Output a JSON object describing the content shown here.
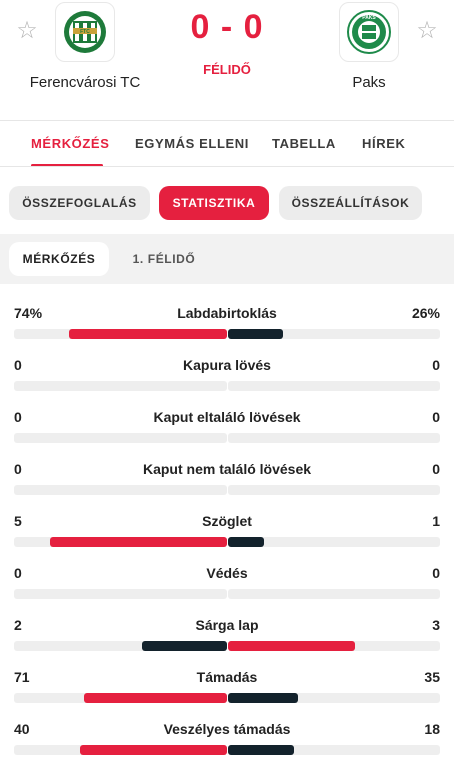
{
  "header": {
    "home_team": "Ferencvárosi TC",
    "away_team": "Paks",
    "score": "0 - 0",
    "status": "FÉLIDŐ",
    "home_logo_text": "FTC",
    "away_logo_text": "PAKS"
  },
  "main_tabs": [
    "MÉRKŐZÉS",
    "EGYMÁS ELLENI",
    "TABELLA",
    "HÍREK"
  ],
  "sub_tabs": [
    "ÖSSZEFOGLALÁS",
    "STATISZTIKA",
    "ÖSSZEÁLLÍTÁSOK"
  ],
  "periods": [
    "MÉRKŐZÉS",
    "1. FÉLIDŐ"
  ],
  "colors": {
    "accent": "#e5203f",
    "dark": "#13222c",
    "track": "#eeeeee"
  },
  "stats": [
    {
      "label": "Labdabirtoklás",
      "home": "74%",
      "away": "26%",
      "home_val": 74,
      "away_val": 26,
      "home_fill": 0.74,
      "away_fill": 0.26,
      "home_color": "#e5203f",
      "away_color": "#13222c"
    },
    {
      "label": "Kapura lövés",
      "home": "0",
      "away": "0",
      "home_val": 0,
      "away_val": 0,
      "home_fill": 0,
      "away_fill": 0,
      "home_color": "#e5203f",
      "away_color": "#13222c"
    },
    {
      "label": "Kaput eltaláló lövések",
      "home": "0",
      "away": "0",
      "home_val": 0,
      "away_val": 0,
      "home_fill": 0,
      "away_fill": 0,
      "home_color": "#e5203f",
      "away_color": "#13222c"
    },
    {
      "label": "Kaput nem találó lövések",
      "home": "0",
      "away": "0",
      "home_val": 0,
      "away_val": 0,
      "home_fill": 0,
      "away_fill": 0,
      "home_color": "#e5203f",
      "away_color": "#13222c"
    },
    {
      "label": "Szöglet",
      "home": "5",
      "away": "1",
      "home_val": 5,
      "away_val": 1,
      "home_fill": 0.83,
      "away_fill": 0.17,
      "home_color": "#e5203f",
      "away_color": "#13222c"
    },
    {
      "label": "Védés",
      "home": "0",
      "away": "0",
      "home_val": 0,
      "away_val": 0,
      "home_fill": 0,
      "away_fill": 0,
      "home_color": "#e5203f",
      "away_color": "#13222c"
    },
    {
      "label": "Sárga lap",
      "home": "2",
      "away": "3",
      "home_val": 2,
      "away_val": 3,
      "home_fill": 0.4,
      "away_fill": 0.6,
      "home_color": "#13222c",
      "away_color": "#e5203f"
    },
    {
      "label": "Támadás",
      "home": "71",
      "away": "35",
      "home_val": 71,
      "away_val": 35,
      "home_fill": 0.67,
      "away_fill": 0.33,
      "home_color": "#e5203f",
      "away_color": "#13222c"
    },
    {
      "label": "Veszélyes támadás",
      "home": "40",
      "away": "18",
      "home_val": 40,
      "away_val": 18,
      "home_fill": 0.69,
      "away_fill": 0.31,
      "home_color": "#e5203f",
      "away_color": "#13222c"
    }
  ]
}
